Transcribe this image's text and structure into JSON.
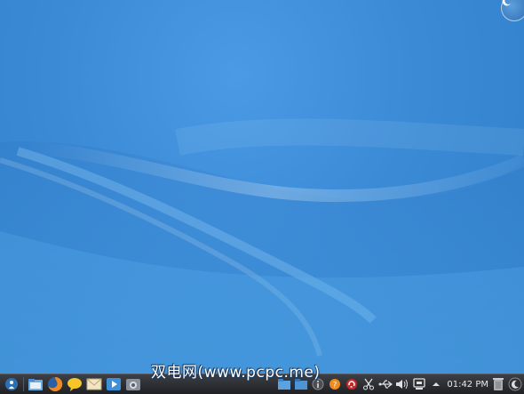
{
  "desktop": {
    "corner_icon": "plasma-toolbox-icon"
  },
  "watermark": {
    "text": "双电网(www.pcpc.me)"
  },
  "taskbar": {
    "launchers": [
      {
        "name": "kickoff-menu-icon"
      },
      {
        "name": "file-manager-icon"
      },
      {
        "name": "firefox-icon"
      },
      {
        "name": "chat-icon"
      },
      {
        "name": "mail-icon"
      },
      {
        "name": "media-player-icon"
      },
      {
        "name": "screenshot-icon"
      }
    ],
    "tray": [
      {
        "name": "folder-icon"
      },
      {
        "name": "folder-blue-icon"
      },
      {
        "name": "info-icon"
      },
      {
        "name": "help-icon"
      },
      {
        "name": "update-icon"
      },
      {
        "name": "scissors-icon"
      },
      {
        "name": "usb-icon"
      },
      {
        "name": "volume-icon"
      },
      {
        "name": "network-icon"
      }
    ],
    "clock": "01:42 PM",
    "trash_icon": "trash-icon",
    "panel_icon": "panel-toolbox-icon"
  },
  "colors": {
    "desktop_blue": "#3a8ad6",
    "taskbar": "#2a2c31",
    "accent_orange": "#f08a1c"
  }
}
